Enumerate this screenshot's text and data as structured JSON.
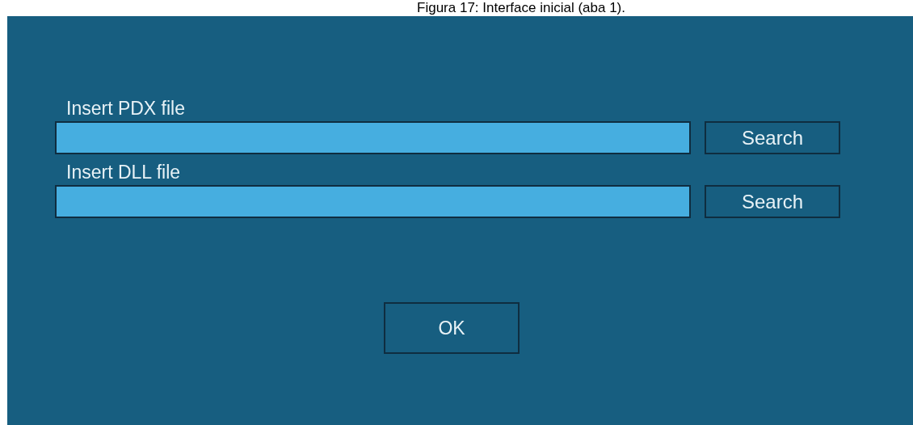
{
  "caption": "Figura 17: Interface inicial (aba 1).",
  "rows": [
    {
      "label": "Insert PDX file",
      "button": "Search"
    },
    {
      "label": "Insert DLL file",
      "button": "Search"
    }
  ],
  "ok_button": "OK"
}
